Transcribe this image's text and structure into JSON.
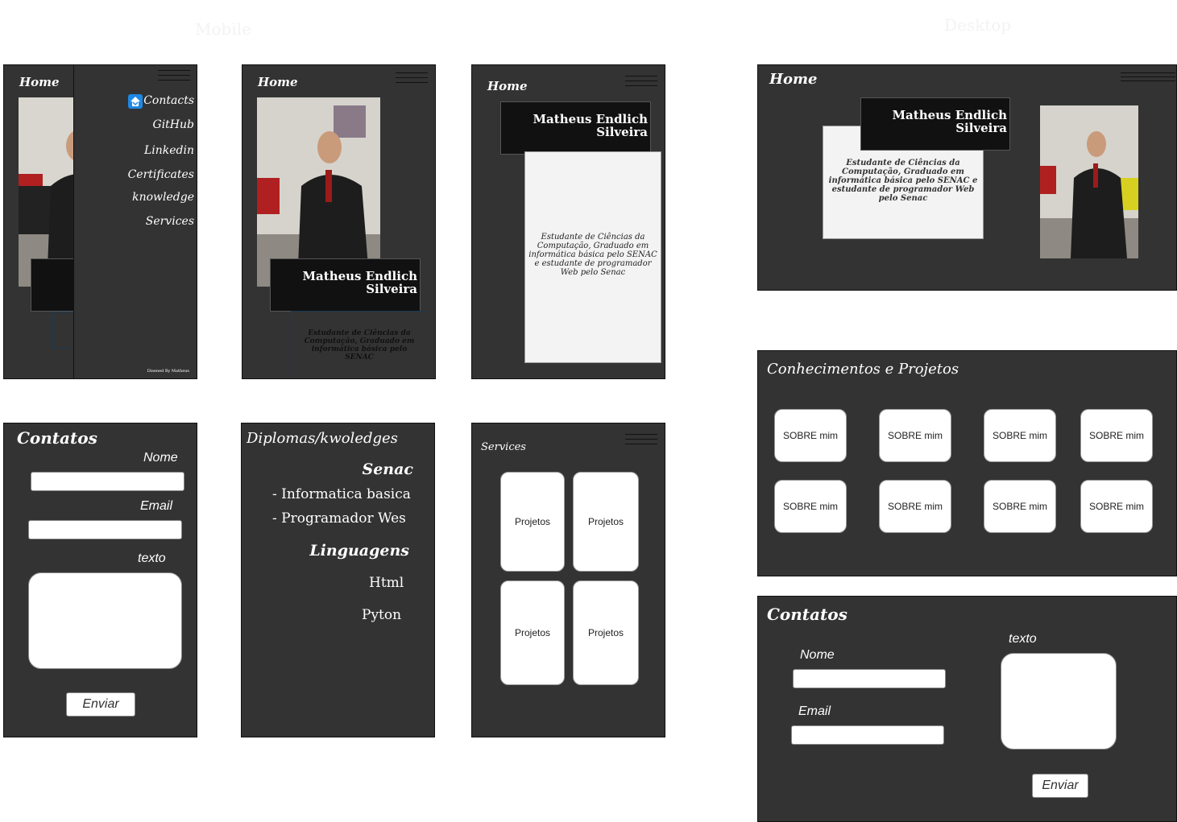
{
  "labels": {
    "mobile": "Mobile",
    "desktop": "Desktop"
  },
  "home_label": "Home",
  "person_name_line1": "Matheus Endlich",
  "person_name_line2": "Silveira",
  "description_full": "Estudante de Ciências da Computação, Graduado em informática básica pelo SENAC e estudante de programador Web pelo Senac",
  "description_short": "Estudante de Ciências da Computação, Graduado em informática básica pelo SENAC",
  "drawer": {
    "items": [
      "Contacts",
      "GitHub",
      "Linkedin",
      "Certificates",
      "knowledge",
      "Services"
    ],
    "footer": "Disened  By Matheus"
  },
  "contact_form": {
    "title": "Contatos",
    "name_label": "Nome",
    "email_label": "Email",
    "text_label": "texto",
    "submit_label": "Enviar"
  },
  "diplomas": {
    "title": "Diplomas/kwoledges",
    "senac": "Senac",
    "items": [
      "- Informatica basica",
      "- Programador Wes"
    ],
    "languages_title": "Linguagens",
    "languages": [
      "Html",
      "Pyton"
    ]
  },
  "services": {
    "title": "Services",
    "cards": [
      "Projetos",
      "Projetos",
      "Projetos",
      "Projetos"
    ]
  },
  "knowledge": {
    "title": "Conhecimentos e Projetos",
    "cards": [
      "SOBRE mim",
      "SOBRE mim",
      "SOBRE mim",
      "SOBRE mim",
      "SOBRE mim",
      "SOBRE mim",
      "SOBRE mim",
      "SOBRE mim"
    ]
  },
  "colors": {
    "panel": "#333333",
    "name_box": "#111111",
    "desc_box": "#f3f3f3",
    "drawer_icon": "#1e88e5"
  },
  "icons": {
    "menu": "hamburger-icon",
    "contacts": "house-icon"
  }
}
